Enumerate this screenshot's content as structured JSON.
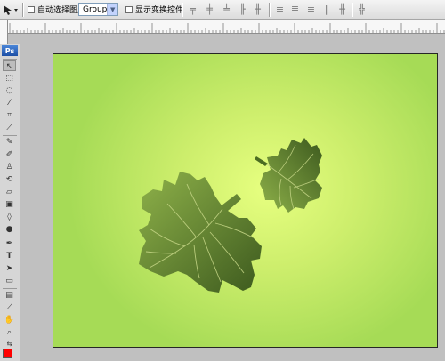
{
  "options_bar": {
    "auto_select_label": "自动选择图层",
    "auto_select_value": "Group",
    "show_transform_label": "显示变换控件"
  },
  "toolbox": {
    "logo": "Ps",
    "tools": [
      "move-tool",
      "marquee-tool",
      "lasso-tool",
      "magic-wand-tool",
      "crop-tool",
      "slice-tool",
      "healing-brush-tool",
      "brush-tool",
      "clone-stamp-tool",
      "history-brush-tool",
      "eraser-tool",
      "gradient-tool",
      "blur-tool",
      "dodge-tool",
      "pen-tool",
      "type-tool",
      "path-selection-tool",
      "shape-tool",
      "notes-tool",
      "eyedropper-tool",
      "hand-tool",
      "zoom-tool"
    ],
    "type_tool_glyph": "T",
    "foreground_color": "#ff0000"
  },
  "canvas": {
    "background_center": "#e7ff80",
    "background_edge": "#a6db56",
    "leaf_color_dark": "#3d5a1e",
    "leaf_color_light": "#8fb24a"
  }
}
